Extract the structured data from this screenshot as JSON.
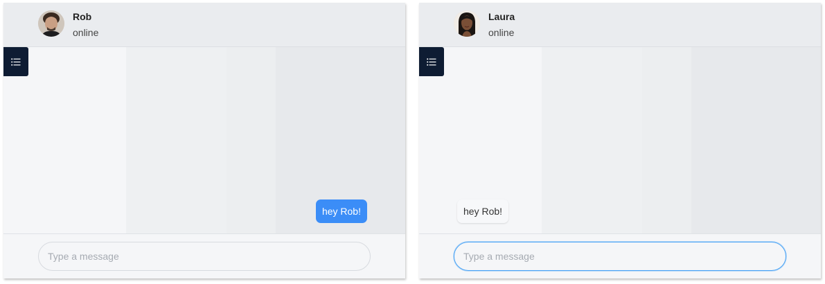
{
  "chats": {
    "left": {
      "contact_name": "Rob",
      "contact_status": "online",
      "avatar_icon": "avatar-rob-icon",
      "message": {
        "text": "hey Rob!",
        "direction": "outgoing",
        "color": "#3b8df7"
      },
      "input_placeholder": "Type a message"
    },
    "right": {
      "contact_name": "Laura",
      "contact_status": "online",
      "avatar_icon": "avatar-laura-icon",
      "message": {
        "text": "hey Rob!",
        "direction": "incoming"
      },
      "input_placeholder": "Type a message"
    }
  },
  "colors": {
    "menu_button": "#0e1c33",
    "outgoing_bubble": "#3b8df7",
    "focus_ring": "#4aa3f5"
  }
}
